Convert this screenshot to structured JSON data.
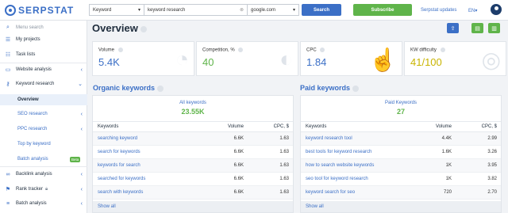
{
  "header": {
    "logo": "SERPSTAT",
    "search_type": "Keyword",
    "search_value": "keyword research",
    "database": "google.com",
    "search_button": "Search",
    "subscribe_button": "Subscribe",
    "updates_link": "Serpstat updates",
    "language": "EN"
  },
  "sidebar": {
    "menu_search": "Menu search",
    "my_projects": "My projects",
    "task_lists": "Task lists",
    "website_analysis": "Website analysis",
    "keyword_research": "Keyword research",
    "overview": "Overview",
    "seo_research": "SEO research",
    "ppc_research": "PPC research",
    "top_by_keyword": "Top by keyword",
    "batch_analysis_sub": "Batch analysis",
    "beta": "Beta",
    "backlink_analysis": "Backlink analysis",
    "rank_tracker": "Rank tracker",
    "batch_analysis": "Batch analysis"
  },
  "page": {
    "title": "Overview"
  },
  "cards": [
    {
      "label": "Volume",
      "value": "5.4K",
      "icon": "chart-icon"
    },
    {
      "label": "Competition, %",
      "value": "40",
      "icon": "fish-icon"
    },
    {
      "label": "CPC",
      "value": "1.84",
      "icon": "cursor-icon"
    },
    {
      "label": "KW difficulty",
      "value": "41/100",
      "icon": "target-icon"
    }
  ],
  "organic": {
    "title": "Organic keywords",
    "summary_label": "All keywords",
    "summary_value": "23.55K",
    "columns": [
      "Keywords",
      "Volume",
      "CPC, $"
    ],
    "rows": [
      {
        "kw": "searching keyword",
        "vol": "6.6K",
        "cpc": "1.63"
      },
      {
        "kw": "search for keywords",
        "vol": "6.6K",
        "cpc": "1.63"
      },
      {
        "kw": "keywords for search",
        "vol": "6.6K",
        "cpc": "1.63"
      },
      {
        "kw": "searched for keywords",
        "vol": "6.6K",
        "cpc": "1.63"
      },
      {
        "kw": "search with keywords",
        "vol": "6.6K",
        "cpc": "1.63"
      }
    ],
    "show_all": "Show all"
  },
  "paid": {
    "title": "Paid keywords",
    "summary_label": "Paid Keywords",
    "summary_value": "27",
    "columns": [
      "Keywords",
      "Volume",
      "CPC, $"
    ],
    "rows": [
      {
        "kw": "keyword research tool",
        "vol": "4.4K",
        "cpc": "2.99"
      },
      {
        "kw": "best tools for keyword research",
        "vol": "1.6K",
        "cpc": "3.26"
      },
      {
        "kw": "how to search website keywords",
        "vol": "1K",
        "cpc": "3.95"
      },
      {
        "kw": "seo tool for keyword research",
        "vol": "1K",
        "cpc": "3.82"
      },
      {
        "kw": "keyword search for seo",
        "vol": "720",
        "cpc": "2.70"
      }
    ],
    "show_all": "Show all"
  },
  "colors": {
    "brand": "#3b6fc6",
    "green": "#5fb44a",
    "yellow": "#c8b400"
  }
}
